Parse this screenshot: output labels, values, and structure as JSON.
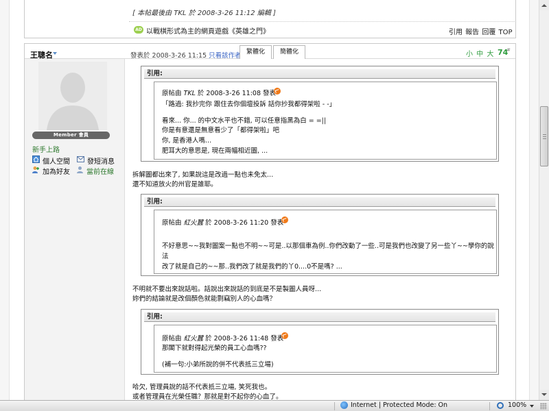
{
  "prev_post": {
    "edit_note": "[ 本帖最後由 TKL 於 2008-3-26 11:12 編輯 ]",
    "ad_badge": "AD",
    "sig_link": "以戰棋形式為主的網頁遊戲《英雄之門》",
    "actions": "引用 報告 回覆 TOP"
  },
  "author": {
    "username": "王聰名",
    "rank_badge": "Member 會員",
    "rank_title": "新手上路",
    "links": {
      "home": "個人空間",
      "message": "發短消息",
      "friend": "加為好友",
      "online": "當前在線"
    }
  },
  "post": {
    "time_prefix": "發表於 2008-3-26 11:15",
    "only_author": "只看該作者",
    "tab_traditional": "繁體化",
    "tab_simplified": "簡體化",
    "font_sizes": "小 中 大",
    "floor": "74",
    "floor_sup": "#"
  },
  "quotes": [
    {
      "label": "引用:",
      "meta_prefix": "原帖由",
      "meta_author": "TKL",
      "meta_suffix": "於 2008-3-26 11:08 發表",
      "lines": [
        "「路過: 我抄完你 跟住去你個壇投訴 話你抄我都得架啦 - -」",
        "看來... 你... 的中文水平也不錯, 可以任意指黑為白 = =||",
        "你是有意還是無意看少了「都得架啦」吧",
        "你, 是香港人嗎...",
        "肥耳大的意思是, 現在兩幅相近圖, ..."
      ]
    },
    {
      "label": "引用:",
      "meta_prefix": "原帖由",
      "meta_author": "紅火蠶",
      "meta_suffix": "於 2008-3-26 11:20 發表",
      "lines": [
        "不好意思~~我對圖案一點也不明~~可是..以那個車為例..你們改動了一些..可是我們也改變了另一些丫~~學你的說",
        "法",
        "改了就是自己的~~那..我們改了就是我們的丫0....0不是嗎? ..."
      ]
    },
    {
      "label": "引用:",
      "meta_prefix": "原帖由",
      "meta_author": "紅火蠶",
      "meta_suffix": "於 2008-3-26 11:48 發表",
      "lines": [
        "那閣下就對得起光榮的員工心血嗎??",
        "(補一句:小弟所說的併不代表抵三立場)"
      ]
    }
  ],
  "body_text": [
    "拆解圖都出來了, 如果說這是改過一點也未免太...",
    "還不知道放火的州官是誰耶。",
    "不明就不要出來說話啦。話說出來說話的到底是不是製圖人員呀...",
    "妳們的結論就是改個顏色就能剽竊別人的心血嗎？",
    "哈欠, 管理員說的話不代表抵三立場, 笑死我也。",
    "或者管理員在光榮任職？那就是對不起你的心血了。"
  ],
  "status_bar": {
    "zone": "Internet | Protected Mode: On",
    "zoom": "100%"
  },
  "colors": {
    "link_blue": "#3c66c4",
    "green_accent": "#2f9c3e",
    "return_orange": "#f07a1a"
  }
}
